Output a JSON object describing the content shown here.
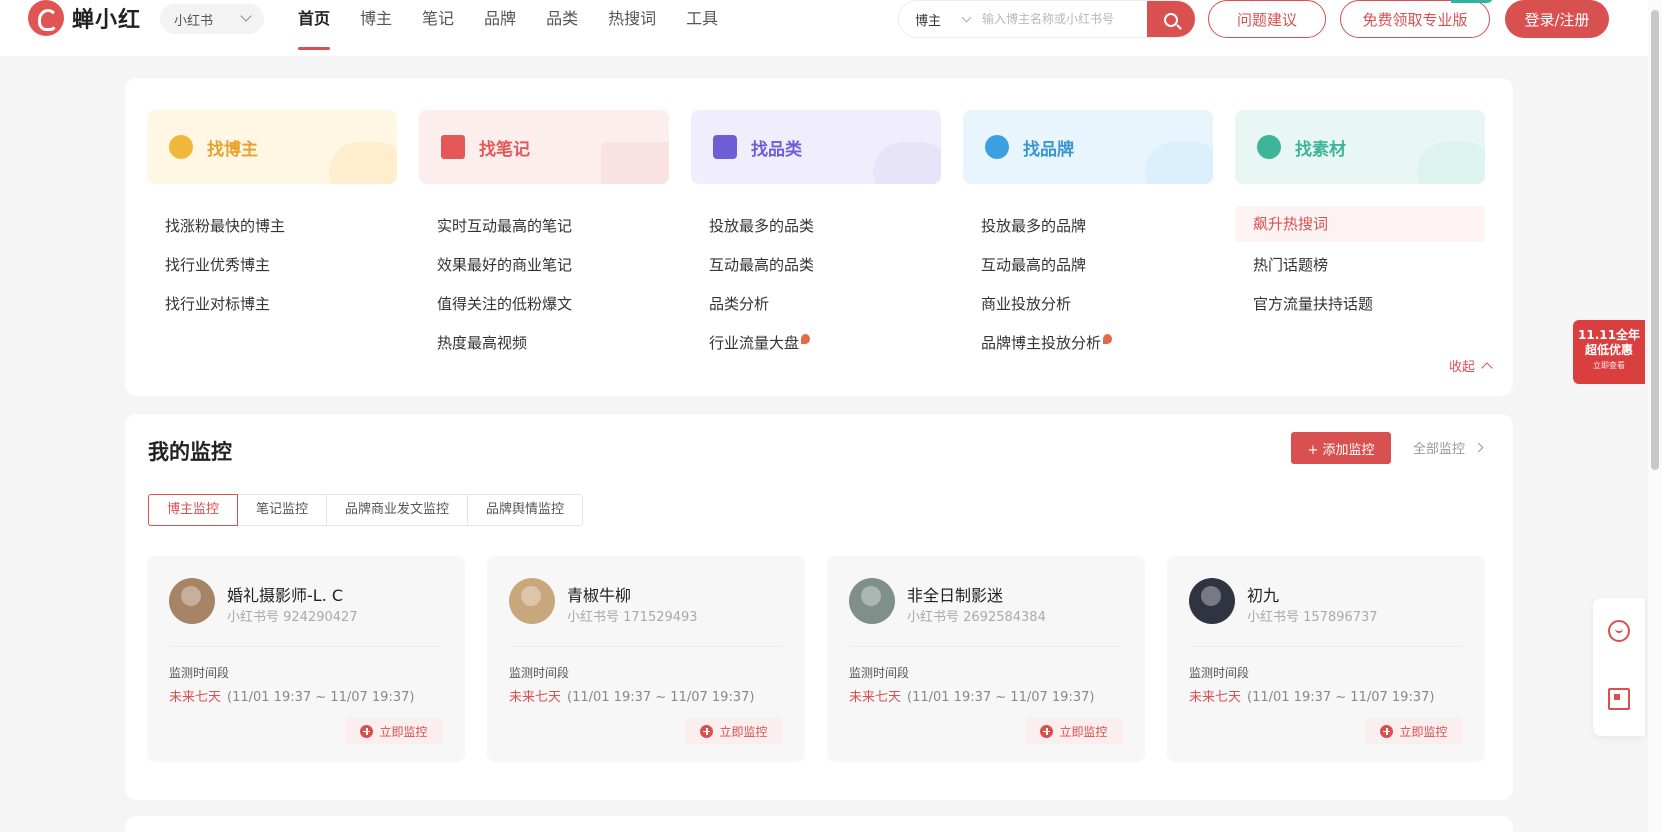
{
  "app": {
    "logo_text": "蝉小红",
    "platform": "小红书"
  },
  "nav": {
    "items": [
      "首页",
      "博主",
      "笔记",
      "品牌",
      "品类",
      "热搜词",
      "工具"
    ],
    "active_index": 0
  },
  "search": {
    "type": "博主",
    "placeholder": "输入博主名称或小红书号"
  },
  "buttons": {
    "feedback": "问题建议",
    "pro": "免费领取专业版",
    "login": "登录/注册"
  },
  "categories": [
    {
      "title": "找博主",
      "color": "#f0a830",
      "bg": "#fff6e4",
      "icon": "search-person-icon",
      "links": [
        "找涨粉最快的博主",
        "找行业优秀博主",
        "找行业对标博主"
      ]
    },
    {
      "title": "找笔记",
      "color": "#e45858",
      "bg": "#fdeeee",
      "icon": "note-icon",
      "links": [
        "实时互动最高的笔记",
        "效果最好的商业笔记",
        "值得关注的低粉爆文",
        "热度最高视频"
      ]
    },
    {
      "title": "找品类",
      "color": "#6e5fd6",
      "bg": "#f0eefc",
      "icon": "store-icon",
      "links": [
        "投放最多的品类",
        "互动最高的品类",
        "品类分析",
        "行业流量大盘"
      ],
      "hot": [
        3
      ]
    },
    {
      "title": "找品牌",
      "color": "#3aa0e0",
      "bg": "#e8f5fd",
      "icon": "brand-icon",
      "links": [
        "投放最多的品牌",
        "互动最高的品牌",
        "商业投放分析",
        "品牌博主投放分析"
      ],
      "hot": [
        3
      ]
    },
    {
      "title": "找素材",
      "color": "#3cb59a",
      "bg": "#e8f7f3",
      "icon": "hashtag-icon",
      "links": [
        "飙升热搜词",
        "热门话题榜",
        "官方流量扶持话题"
      ],
      "highlight": 0
    }
  ],
  "collapse_label": "收起",
  "monitor": {
    "title": "我的监控",
    "add_label": "+ 添加监控",
    "all_label": "全部监控",
    "tabs": [
      "博主监控",
      "笔记监控",
      "品牌商业发文监控",
      "品牌舆情监控"
    ],
    "active_tab": 0,
    "period_label": "监测时间段",
    "period_red": "未来七天",
    "period_range": "(11/01 19:37 ~ 11/07 19:37)",
    "action_label": "立即监控",
    "cards": [
      {
        "name": "婚礼摄影师-L. C",
        "id": "小红书号 924290427",
        "avatar_color": "#a88466"
      },
      {
        "name": "青椒牛柳",
        "id": "小红书号 171529493",
        "avatar_color": "#c9a77c"
      },
      {
        "name": "非全日制影迷",
        "id": "小红书号 2692584384",
        "avatar_color": "#7f8f8a"
      },
      {
        "name": "初九",
        "id": "小红书号 157896737",
        "avatar_color": "#2f3440"
      }
    ]
  },
  "promo": {
    "line1": "11.11全年",
    "line2": "超低优惠",
    "line3": "立即查看"
  },
  "colors": {
    "accent": "#d95050"
  }
}
